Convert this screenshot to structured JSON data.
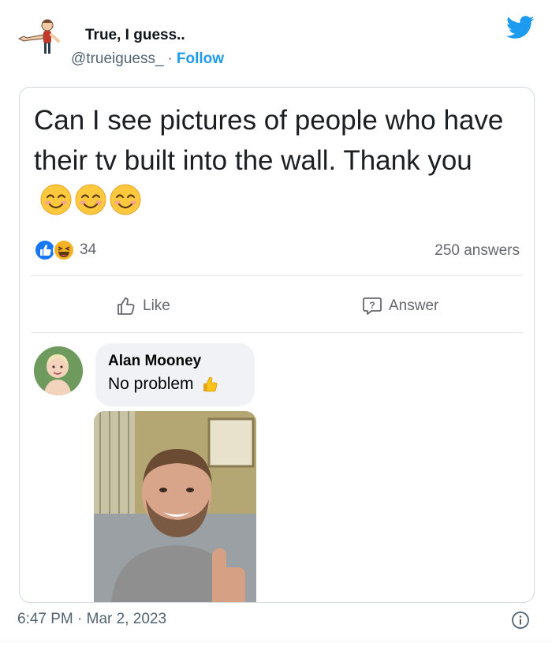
{
  "tweet": {
    "author_name": "True, I guess..",
    "handle": "@trueiguess_",
    "separator": "·",
    "follow_label": "Follow",
    "timestamp": "6:47 PM · Mar 2, 2023"
  },
  "post": {
    "question": "Can I see pictures of people who have their tv built into the wall. Thank you",
    "emoji_count": 3,
    "reaction_count": "34",
    "answers_count": "250 answers",
    "like_label": "Like",
    "answer_label": "Answer"
  },
  "comment": {
    "author": "Alan Mooney",
    "text": "No problem"
  },
  "colors": {
    "twitter_blue": "#1d9bf0",
    "facebook_blue": "#1877f2",
    "muted_text": "#536471",
    "bubble_bg": "#f0f2f5"
  },
  "icons": [
    "twitter-bird-icon",
    "like-reaction-icon",
    "haha-reaction-icon",
    "thumbs-up-outline-icon",
    "answer-question-icon",
    "thumbs-up-emoji",
    "info-icon"
  ]
}
